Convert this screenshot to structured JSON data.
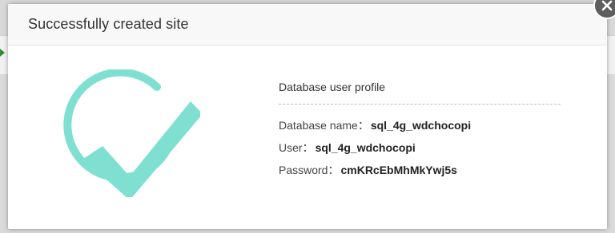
{
  "modal": {
    "title": "Successfully created site",
    "success_icon": "check-circle-icon",
    "close_icon": "close-icon",
    "accent_color": "#7fe0d2"
  },
  "profile": {
    "heading": "Database user profile",
    "rows": [
      {
        "label": "Database name：",
        "value": "sql_4g_wdchocopi"
      },
      {
        "label": "User：",
        "value": "sql_4g_wdchocopi"
      },
      {
        "label": "Password：",
        "value": "cmKRcEbMhMkYwj5s"
      }
    ]
  }
}
